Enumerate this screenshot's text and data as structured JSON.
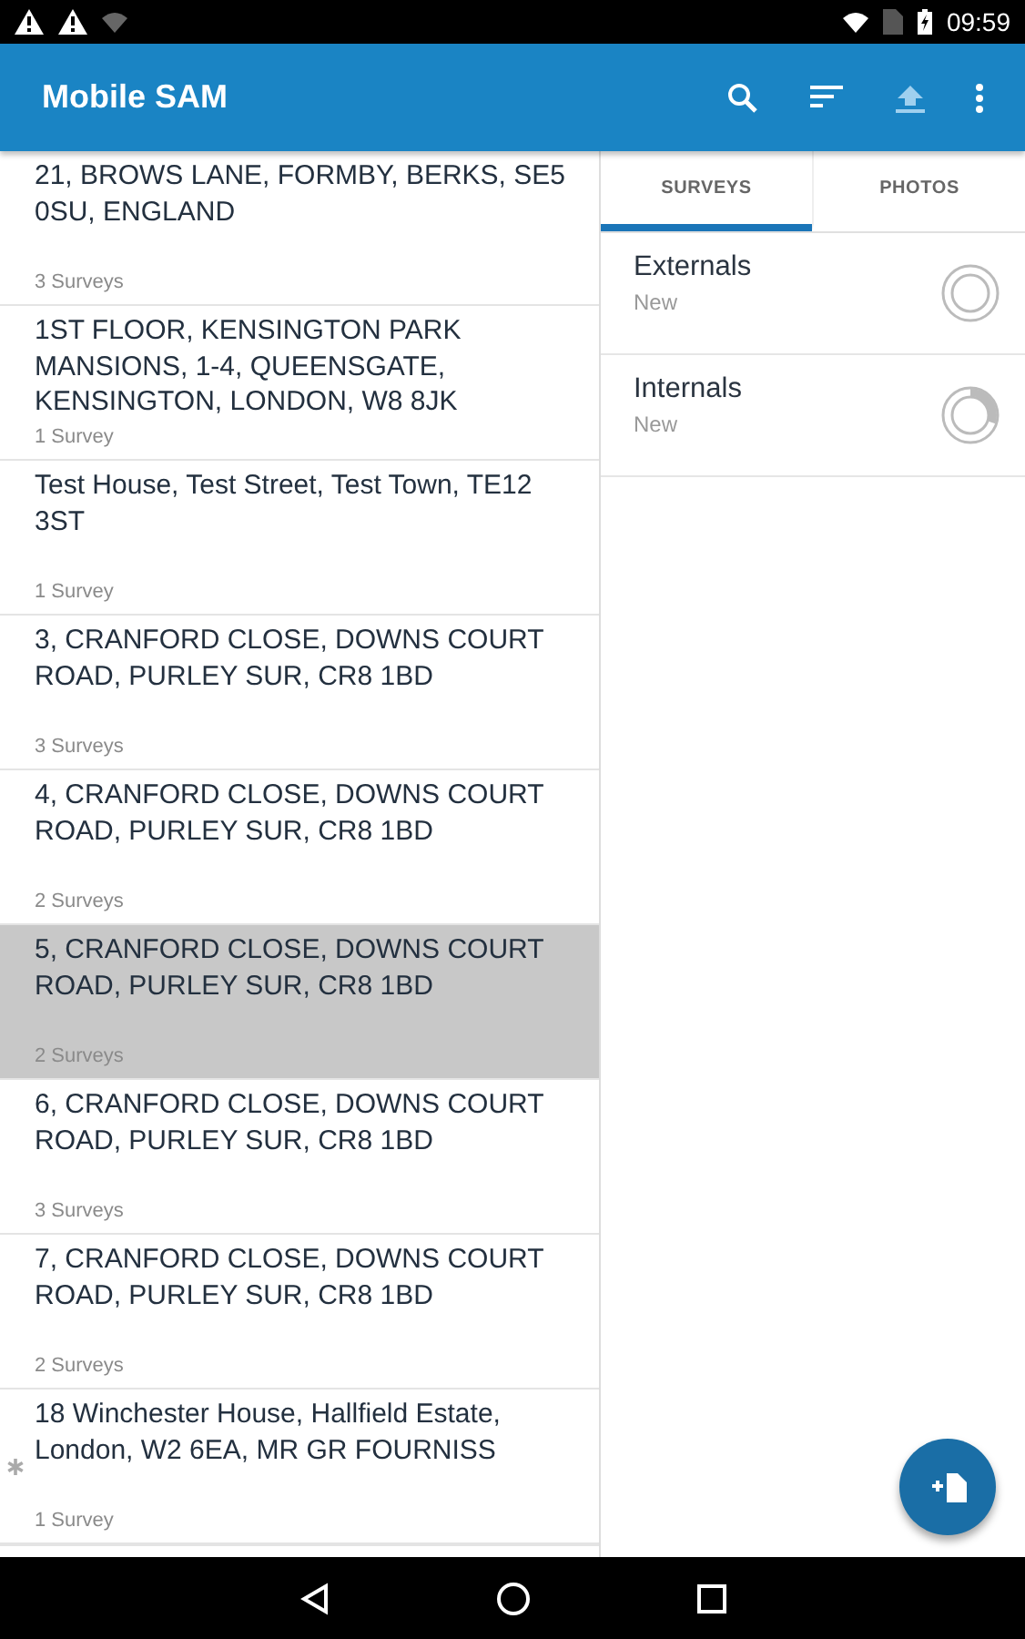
{
  "status_bar": {
    "time": "09:59"
  },
  "app_bar": {
    "title": "Mobile SAM"
  },
  "properties": [
    {
      "address": "21, BROWS LANE, FORMBY, BERKS, SE5 0SU, ENGLAND",
      "count": "3 Surveys",
      "selected": false,
      "flagged": false
    },
    {
      "address": "1ST FLOOR, KENSINGTON PARK MANSIONS, 1-4, QUEENSGATE, KENSINGTON, LONDON, W8 8JK",
      "count": "1 Survey",
      "selected": false,
      "flagged": false
    },
    {
      "address": "Test House, Test Street, Test Town, TE12 3ST",
      "count": "1 Survey",
      "selected": false,
      "flagged": false
    },
    {
      "address": "3, CRANFORD CLOSE, DOWNS COURT ROAD, PURLEY SUR, CR8 1BD",
      "count": "3 Surveys",
      "selected": false,
      "flagged": false
    },
    {
      "address": "4, CRANFORD CLOSE, DOWNS COURT ROAD, PURLEY SUR, CR8 1BD",
      "count": "2 Surveys",
      "selected": false,
      "flagged": false
    },
    {
      "address": "5, CRANFORD CLOSE, DOWNS COURT ROAD, PURLEY SUR, CR8 1BD",
      "count": "2 Surveys",
      "selected": true,
      "flagged": false
    },
    {
      "address": "6, CRANFORD CLOSE, DOWNS COURT ROAD, PURLEY SUR, CR8 1BD",
      "count": "3 Surveys",
      "selected": false,
      "flagged": false
    },
    {
      "address": "7, CRANFORD CLOSE, DOWNS COURT ROAD, PURLEY SUR, CR8 1BD",
      "count": "2 Surveys",
      "selected": false,
      "flagged": false
    },
    {
      "address": "18 Winchester House, Hallfield Estate, London, W2 6EA, MR GR FOURNISS",
      "count": "1 Survey",
      "selected": false,
      "flagged": true
    }
  ],
  "tabs": [
    {
      "label": "SURVEYS",
      "selected": true
    },
    {
      "label": "PHOTOS",
      "selected": false
    }
  ],
  "surveys": [
    {
      "name": "Externals",
      "status": "New"
    },
    {
      "name": "Internals",
      "status": "New",
      "level": 0.3
    }
  ]
}
